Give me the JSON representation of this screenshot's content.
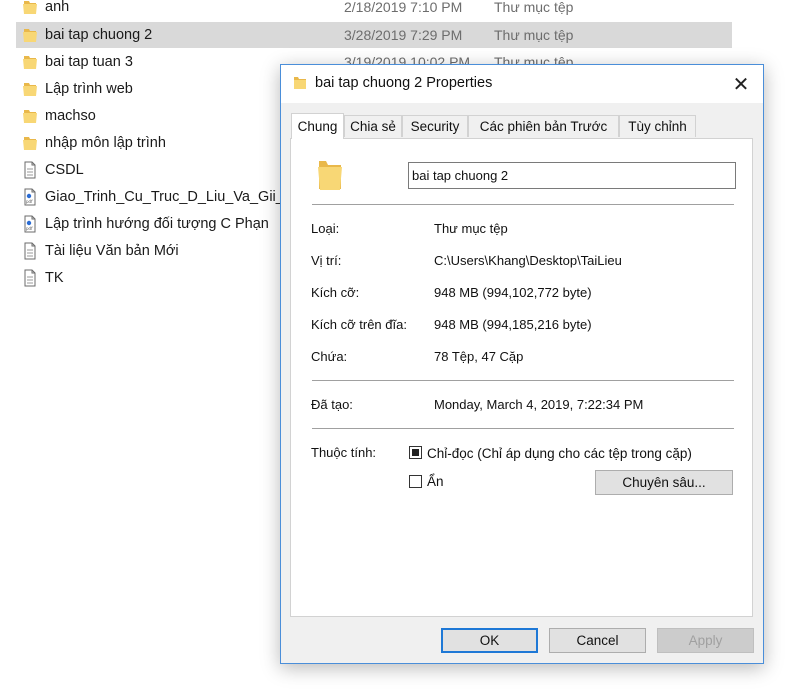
{
  "explorer": {
    "files": [
      {
        "name": "anh",
        "kind": "folder",
        "date": "2/18/2019 7:10 PM",
        "type": "Thư mục tệp",
        "selected": false
      },
      {
        "name": "bai tap chuong 2",
        "kind": "folder",
        "date": "3/28/2019 7:29 PM",
        "type": "Thư mục tệp",
        "selected": true
      },
      {
        "name": "bai tap tuan 3",
        "kind": "folder",
        "date": "3/19/2019 10:02 PM",
        "type": "Thư mục tệp",
        "selected": false
      },
      {
        "name": "Lập trình web",
        "kind": "folder",
        "date": "",
        "type": "",
        "selected": false
      },
      {
        "name": "machso",
        "kind": "folder",
        "date": "",
        "type": "",
        "selected": false
      },
      {
        "name": "nhập môn lập trình",
        "kind": "folder",
        "date": "",
        "type": "",
        "selected": false
      },
      {
        "name": "CSDL",
        "kind": "document",
        "date": "",
        "type": "",
        "selected": false
      },
      {
        "name": "Giao_Trinh_Cu_Truc_D_Liu_Va_Gii_Th",
        "kind": "pdf",
        "date": "",
        "type": "",
        "selected": false
      },
      {
        "name": "Lập trình hướng đối tượng C    Phạn",
        "kind": "pdf",
        "date": "",
        "type": "",
        "selected": false
      },
      {
        "name": "Tài liệu Văn bản Mới",
        "kind": "document",
        "date": "",
        "type": "",
        "selected": false
      },
      {
        "name": "TK",
        "kind": "document",
        "date": "",
        "type": "",
        "selected": false
      }
    ]
  },
  "dialog": {
    "title": "bai tap chuong 2 Properties",
    "close_glyph": "✕",
    "tabs": [
      {
        "label": "Chung",
        "active": true
      },
      {
        "label": "Chia sẻ",
        "active": false
      },
      {
        "label": "Security",
        "active": false
      },
      {
        "label": "Các phiên bản Trước",
        "active": false
      },
      {
        "label": "Tùy chỉnh",
        "active": false
      }
    ],
    "folder_name": "bai tap chuong 2",
    "properties": [
      {
        "label": "Loại:",
        "value": "Thư mục tệp"
      },
      {
        "label": "Vị trí:",
        "value": "C:\\Users\\Khang\\Desktop\\TaiLieu"
      },
      {
        "label": "Kích cỡ:",
        "value": "948 MB (994,102,772 byte)"
      },
      {
        "label": "Kích cỡ trên đĩa:",
        "value": "948 MB (994,185,216 byte)"
      },
      {
        "label": "Chứa:",
        "value": "78 Tệp, 47 Cặp"
      }
    ],
    "created": {
      "label": "Đã tạo:",
      "value": "Monday, March 4, 2019, 7:22:34 PM"
    },
    "attributes": {
      "label": "Thuộc tính:",
      "readonly_label": "Chỉ-đọc (Chỉ áp dụng cho các tệp trong cặp)",
      "readonly_state": "indeterminate",
      "hidden_label": "Ẩn",
      "hidden_checked": false,
      "advanced_button": "Chuyên sâu..."
    },
    "buttons": {
      "ok": "OK",
      "cancel": "Cancel",
      "apply": "Apply"
    }
  },
  "colors": {
    "selected_row": "#d9d9d9",
    "folder_yellow": "#f8d775",
    "dialog_border": "#4a8ed9",
    "primary_button_border": "#1e78d6"
  }
}
